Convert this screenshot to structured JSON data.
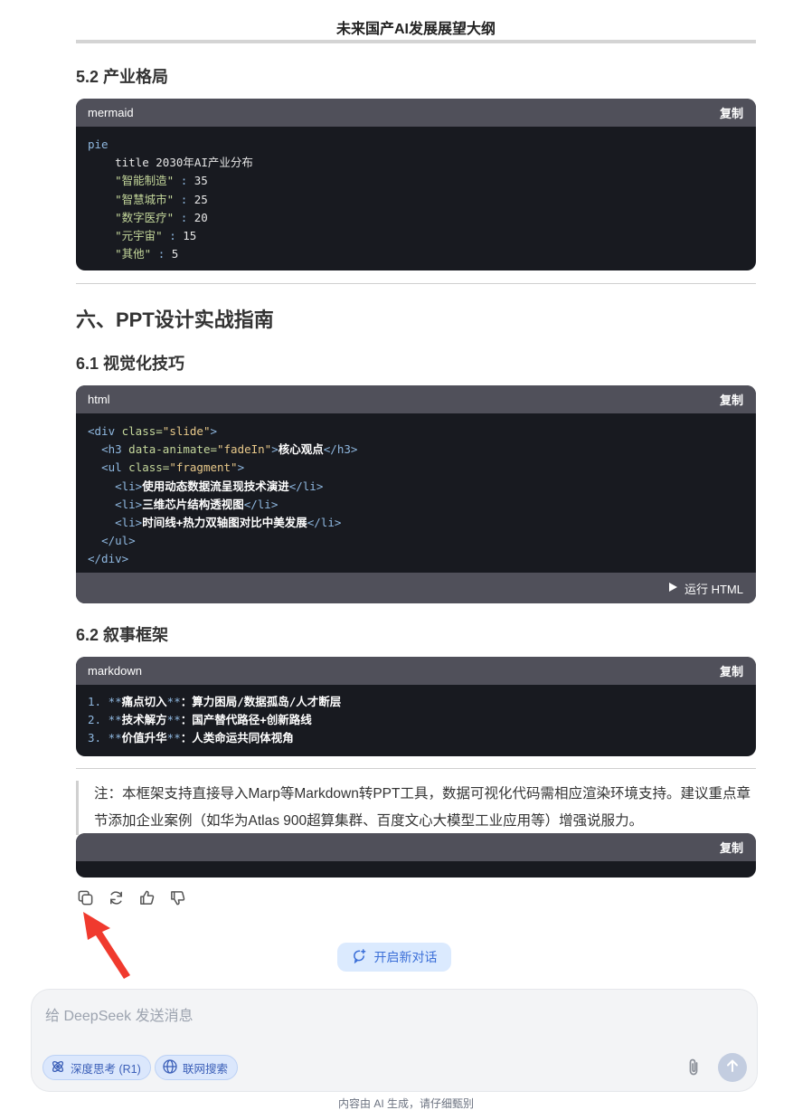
{
  "document": {
    "title": "未来国产AI发展展望大纲"
  },
  "sections": {
    "s52": {
      "heading": "5.2 产业格局"
    },
    "s6": {
      "heading": "六、PPT设计实战指南"
    },
    "s61": {
      "heading": "6.1 视觉化技巧"
    },
    "s62": {
      "heading": "6.2 叙事框架"
    }
  },
  "code_blocks": {
    "mermaid": {
      "lang": "mermaid",
      "copy_label": "复制",
      "lines": {
        "l1": "pie",
        "l2_kw": "title",
        "l2_text": " 2030年AI产业分布",
        "l3_key": "\"智能制造\"",
        "l3_val": "35",
        "l4_key": "\"智慧城市\"",
        "l4_val": "25",
        "l5_key": "\"数字医疗\"",
        "l5_val": "20",
        "l6_key": "\"元宇宙\"",
        "l6_val": "15",
        "l7_key": "\"其他\"",
        "l7_val": "5"
      }
    },
    "html": {
      "lang": "html",
      "copy_label": "复制",
      "run_label": "运行 HTML",
      "lines": {
        "div_open_tag": "<div",
        "div_attr": " class=",
        "div_val": "\"slide\"",
        "h3_open": "<h3",
        "h3_attr": " data-animate=",
        "h3_val": "\"fadeIn\"",
        "h3_text": "核心观点",
        "h3_close": "</h3>",
        "ul_open": "<ul",
        "ul_attr": " class=",
        "ul_val": "\"fragment\"",
        "li1_text": "使用动态数据流呈现技术演进",
        "li2_text": "三维芯片结构透视图",
        "li3_text": "时间线+热力双轴图对比中美发展",
        "ul_close": "</ul>",
        "div_close": "</div>"
      }
    },
    "markdown": {
      "lang": "markdown",
      "copy_label": "复制",
      "items": [
        {
          "num": "1.",
          "bold": "痛点切入",
          "rest": "：算力困局/数据孤岛/人才断层"
        },
        {
          "num": "2.",
          "bold": "技术解方",
          "rest": "：国产替代路径+创新路线"
        },
        {
          "num": "3.",
          "bold": "价值升华",
          "rest": "：人类命运共同体视角"
        }
      ]
    },
    "empty": {
      "copy_label": "复制"
    }
  },
  "note": {
    "text": "注：本框架支持直接导入Marp等Markdown转PPT工具，数据可视化代码需相应渲染环境支持。建议重点章节添加企业案例（如华为Atlas 900超算集群、百度文心大模型工业应用等）增强说服力。"
  },
  "actions": [
    "copy-icon",
    "regenerate-icon",
    "thumbs-up-icon",
    "thumbs-down-icon"
  ],
  "new_chat": {
    "label": "开启新对话"
  },
  "composer": {
    "placeholder": "给 DeepSeek 发送消息",
    "deep_think_label": "深度思考 (R1)",
    "web_search_label": "联网搜索"
  },
  "footer": {
    "disclaimer": "内容由 AI 生成，请仔细甄别"
  },
  "colors": {
    "accent": "#3b6fd8",
    "code_bg": "#181a20",
    "code_header": "#50505a",
    "arrow": "#f03a2e"
  }
}
